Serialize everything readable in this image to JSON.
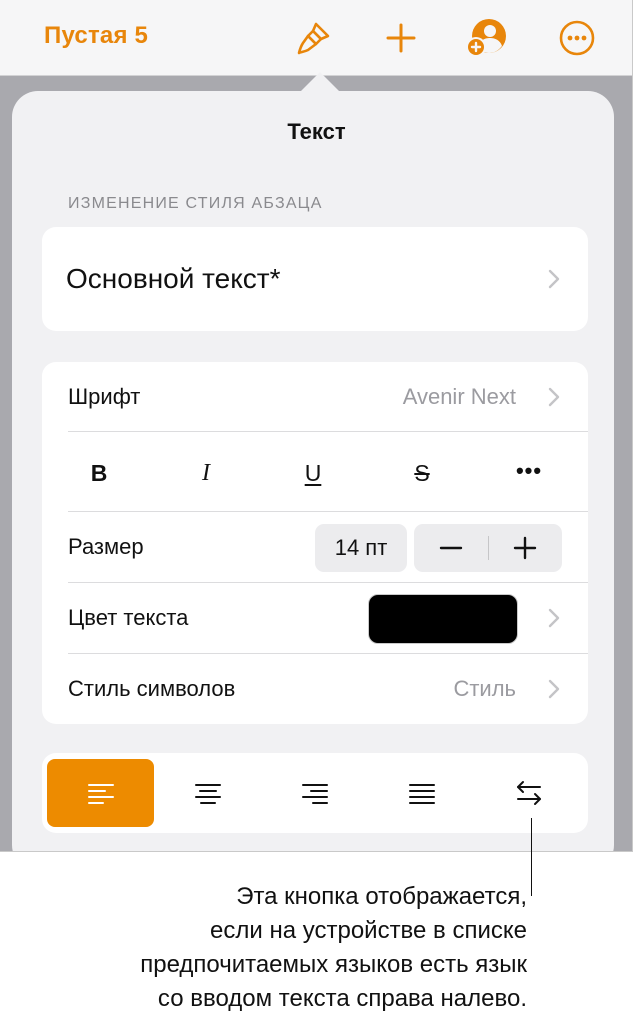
{
  "toolbar": {
    "title": "Пустая 5",
    "icons": [
      "paintbrush-icon",
      "plus-icon",
      "collaborate-icon",
      "more-icon"
    ],
    "accent": "#e8860b"
  },
  "panel": {
    "title": "Текст",
    "section_header": "ИЗМЕНЕНИЕ СТИЛЯ АБЗАЦА",
    "paragraph_style": "Основной текст*"
  },
  "font": {
    "label": "Шрифт",
    "value": "Avenir Next"
  },
  "format_buttons": {
    "bold": "B",
    "italic": "I",
    "underline": "U",
    "strikethrough": "S",
    "more": "•••"
  },
  "size": {
    "label": "Размер",
    "value": "14 пт"
  },
  "text_color": {
    "label": "Цвет текста",
    "color": "#000000"
  },
  "char_style": {
    "label": "Стиль символов",
    "value": "Стиль"
  },
  "alignment": {
    "options": [
      "left",
      "center",
      "right",
      "justify",
      "right-to-left"
    ],
    "selected": "left",
    "active_color": "#ed8b00"
  },
  "callout": {
    "lines": [
      "Эта кнопка отображается,",
      "если на устройстве в списке",
      "предпочитаемых языков есть язык",
      "со вводом текста справа налево."
    ]
  }
}
